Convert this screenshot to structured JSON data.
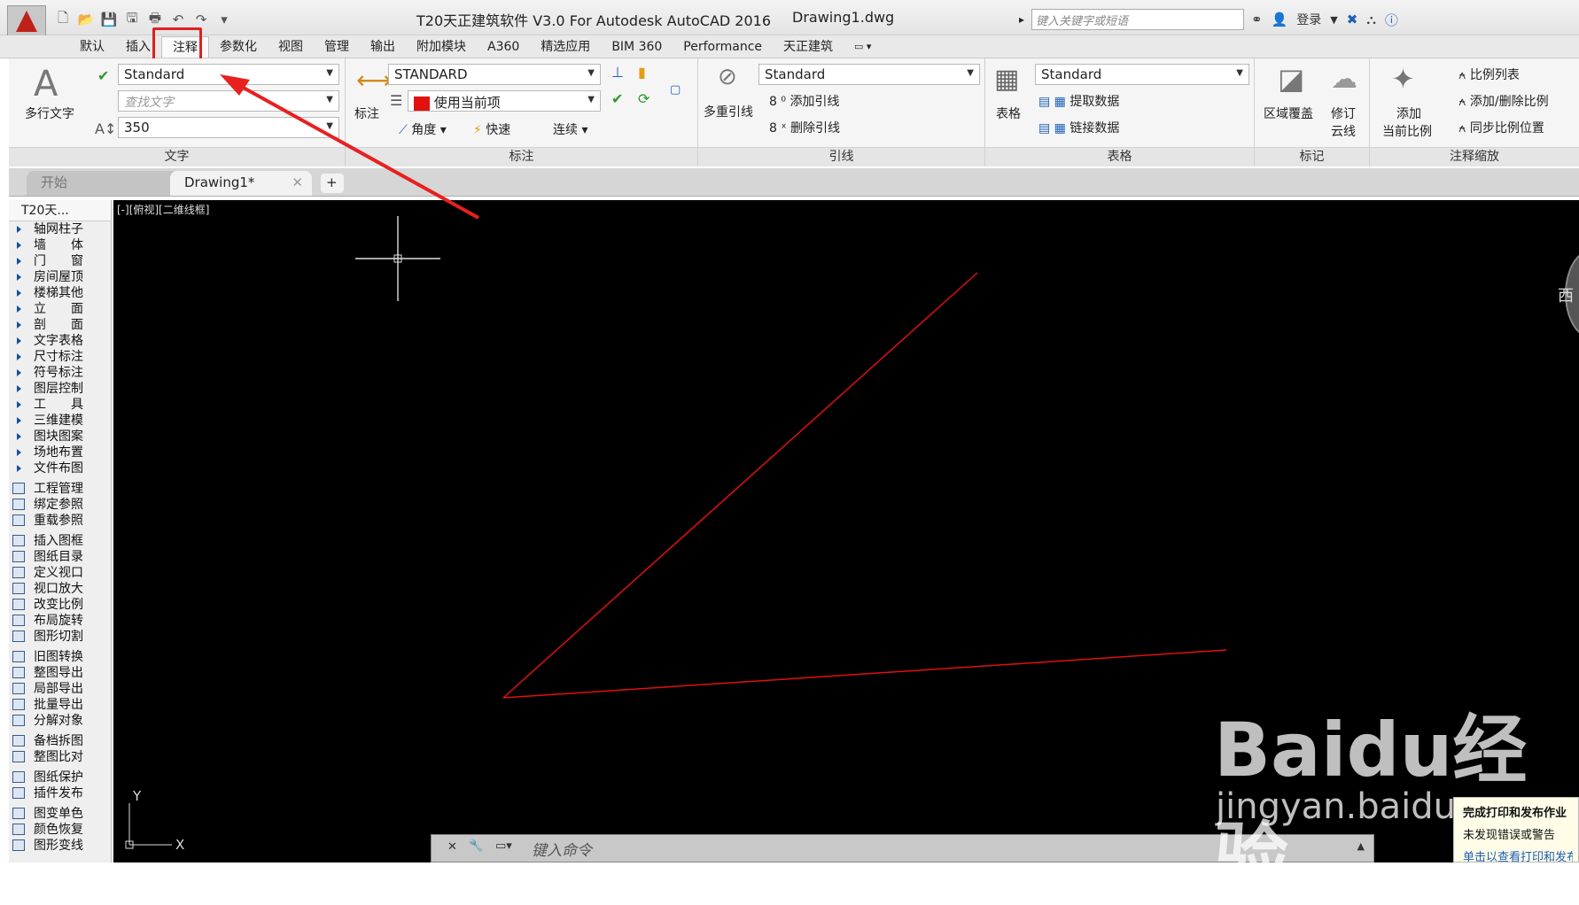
{
  "titlebar": {
    "title": "T20天正建筑软件 V3.0 For Autodesk AutoCAD 2016",
    "filename": "Drawing1.dwg",
    "search_placeholder": "键入关键字或短语",
    "login": "登录"
  },
  "menu_tabs": [
    "默认",
    "插入",
    "注释",
    "参数化",
    "视图",
    "管理",
    "输出",
    "附加模块",
    "A360",
    "精选应用",
    "BIM 360",
    "Performance",
    "天正建筑"
  ],
  "active_tab": "注释",
  "ribbon": {
    "text_panel": {
      "title": "文字",
      "mtext_label": "多行文字",
      "style_value": "Standard",
      "find_placeholder": "查找文字",
      "height_value": "350"
    },
    "dim_panel": {
      "title": "标注",
      "dim_label": "标注",
      "style_value": "STANDARD",
      "layer_value": "使用当前项",
      "angle": "角度",
      "quick": "快速",
      "continue": "连续"
    },
    "leader_panel": {
      "title": "引线",
      "multileader": "多重引线",
      "style_value": "Standard",
      "add": "添加引线",
      "remove": "删除引线"
    },
    "table_panel": {
      "title": "表格",
      "table": "表格",
      "style_value": "Standard",
      "extract": "提取数据",
      "link": "链接数据"
    },
    "mark_panel": {
      "title": "标记",
      "wipeout": "区域覆盖",
      "revcloud_1": "修订",
      "revcloud_2": "云线"
    },
    "scale_panel": {
      "title": "注释缩放",
      "add_1": "添加",
      "add_2": "当前比例",
      "scale_list": "比例列表",
      "add_remove": "添加/删除比例",
      "sync": "同步比例位置"
    }
  },
  "doc_tabs": {
    "start": "开始",
    "drawing": "Drawing1*"
  },
  "palette": {
    "title": "T20天...",
    "tree_items": [
      "轴网柱子",
      "墙　　体",
      "门　　窗",
      "房间屋顶",
      "楼梯其他",
      "立　　面",
      "剖　　面",
      "文字表格",
      "尺寸标注",
      "符号标注",
      "图层控制",
      "工　　具",
      "三维建模",
      "图块图案",
      "场地布置",
      "文件布图"
    ],
    "group1": [
      "工程管理",
      "绑定参照",
      "重载参照"
    ],
    "group2": [
      "插入图框",
      "图纸目录",
      "定义视口",
      "视口放大",
      "改变比例",
      "布局旋转",
      "图形切割"
    ],
    "group3": [
      "旧图转换",
      "整图导出",
      "局部导出",
      "批量导出",
      "分解对象"
    ],
    "group4": [
      "备档拆图",
      "整图比对"
    ],
    "group5": [
      "图纸保护",
      "插件发布"
    ],
    "group6": [
      "图变单色",
      "颜色恢复",
      "图形变线"
    ]
  },
  "canvas": {
    "view_label": "[-][俯视][二维线框]",
    "line_color": "#e01010",
    "axis_x": "X",
    "axis_y": "Y",
    "compass": "西"
  },
  "command": {
    "placeholder": "键入命令"
  },
  "notification": {
    "line1": "完成打印和发布作业",
    "line2": "未发现错误或警告",
    "line3": "单击以查看打印和发布详细信息"
  },
  "watermark": {
    "brand": "Baidu经验",
    "url": "jingyan.baidu.com"
  }
}
